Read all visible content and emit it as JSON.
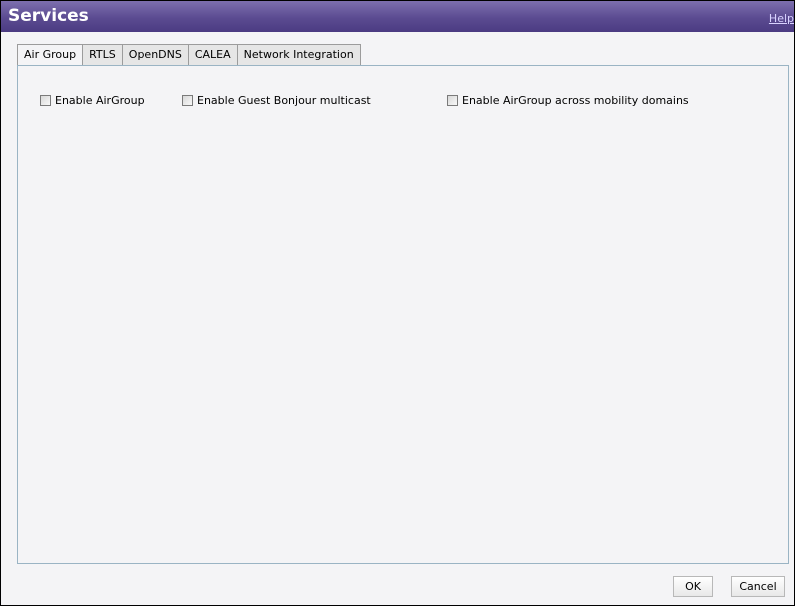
{
  "window": {
    "title": "Services",
    "help_label": "Help"
  },
  "tabs": [
    {
      "label": "Air Group",
      "active": true
    },
    {
      "label": "RTLS",
      "active": false
    },
    {
      "label": "OpenDNS",
      "active": false
    },
    {
      "label": "CALEA",
      "active": false
    },
    {
      "label": "Network Integration",
      "active": false
    }
  ],
  "airgroup": {
    "enable_airgroup_label": "Enable AirGroup",
    "enable_airgroup_checked": false,
    "enable_guest_bonjour_label": "Enable Guest Bonjour multicast",
    "enable_guest_bonjour_checked": false,
    "enable_across_domains_label": "Enable AirGroup across mobility domains",
    "enable_across_domains_checked": false
  },
  "footer": {
    "ok_label": "OK",
    "cancel_label": "Cancel"
  },
  "colors": {
    "titlebar": "#5b4b91",
    "panel_border": "#9ab4c4",
    "background": "#f4f4f6"
  }
}
